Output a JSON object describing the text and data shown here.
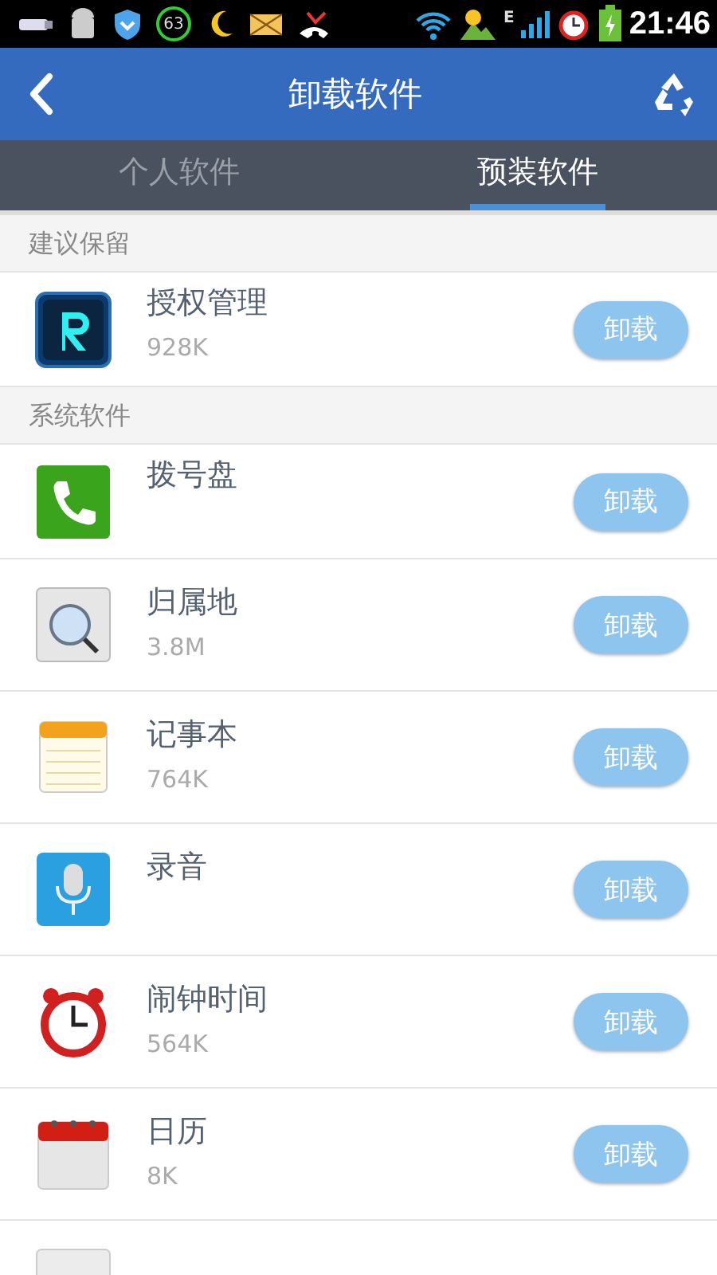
{
  "status_bar": {
    "badge": "63",
    "network": "E",
    "time": "21:46"
  },
  "header": {
    "title": "卸载软件"
  },
  "tabs": [
    {
      "label": "个人软件",
      "selected": false
    },
    {
      "label": "预装软件",
      "selected": true
    }
  ],
  "sections": [
    {
      "title": "建议保留",
      "apps": [
        {
          "kind": "r",
          "name": "授权管理",
          "size": "928K",
          "button": "卸载"
        }
      ]
    },
    {
      "title": "系统软件",
      "apps": [
        {
          "kind": "phone",
          "name": "拨号盘",
          "button": "卸载"
        },
        {
          "kind": "location",
          "name": "归属地",
          "size": "3.8M",
          "button": "卸载"
        },
        {
          "kind": "notepad",
          "name": "记事本",
          "size": "764K",
          "button": "卸载"
        },
        {
          "kind": "mic",
          "name": "录音",
          "button": "卸载"
        },
        {
          "kind": "clock",
          "name": "闹钟时间",
          "size": "564K",
          "button": "卸载"
        },
        {
          "kind": "calendar",
          "name": "日历",
          "size": "8K",
          "button": "卸载"
        },
        {
          "kind": "plain"
        }
      ]
    }
  ]
}
